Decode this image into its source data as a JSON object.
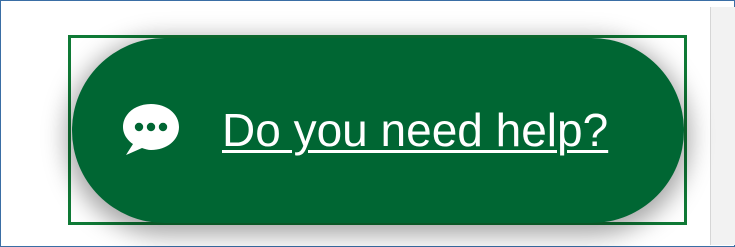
{
  "help_widget": {
    "label": "Do you need help?",
    "icon": "chat-bubble-icon",
    "colors": {
      "button_background": "#006633",
      "outline": "#0f7a36",
      "text": "#ffffff"
    }
  }
}
